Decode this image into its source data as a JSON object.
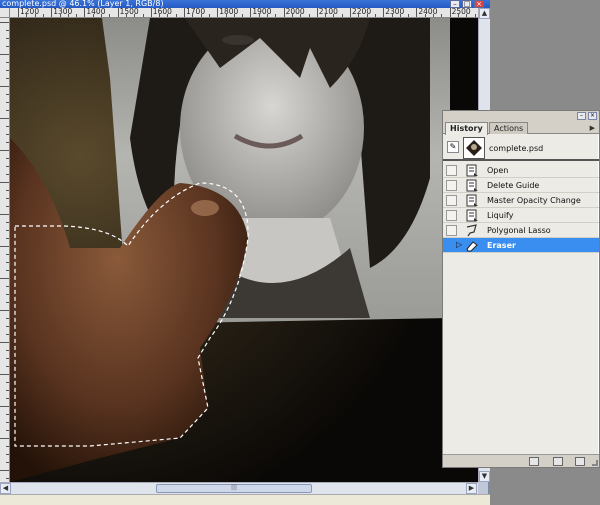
{
  "document": {
    "title": "complete.psd @ 46.1% (Layer 1, RGB/8)",
    "ruler_top_labels": [
      "1200",
      "1300",
      "1400",
      "1500",
      "1600",
      "1700",
      "1800",
      "1900",
      "2000",
      "2100",
      "2200",
      "2300",
      "2400",
      "2500"
    ]
  },
  "history_panel": {
    "tabs": [
      {
        "label": "History",
        "active": true
      },
      {
        "label": "Actions",
        "active": false
      }
    ],
    "snapshot": {
      "label": "complete.psd"
    },
    "items": [
      {
        "label": "Open",
        "icon": "document-icon",
        "selected": false
      },
      {
        "label": "Delete Guide",
        "icon": "document-icon",
        "selected": false
      },
      {
        "label": "Master Opacity Change",
        "icon": "document-icon",
        "selected": false
      },
      {
        "label": "Liquify",
        "icon": "document-icon",
        "selected": false
      },
      {
        "label": "Polygonal Lasso",
        "icon": "lasso-icon",
        "selected": false
      },
      {
        "label": "Eraser",
        "icon": "eraser-icon",
        "selected": true
      }
    ],
    "bottom_buttons": [
      "new-document-from-state-icon",
      "camera-snapshot-icon",
      "trash-icon"
    ]
  },
  "colors": {
    "selected_row": "#3a8ef0",
    "titlebar": "#2458c4"
  }
}
